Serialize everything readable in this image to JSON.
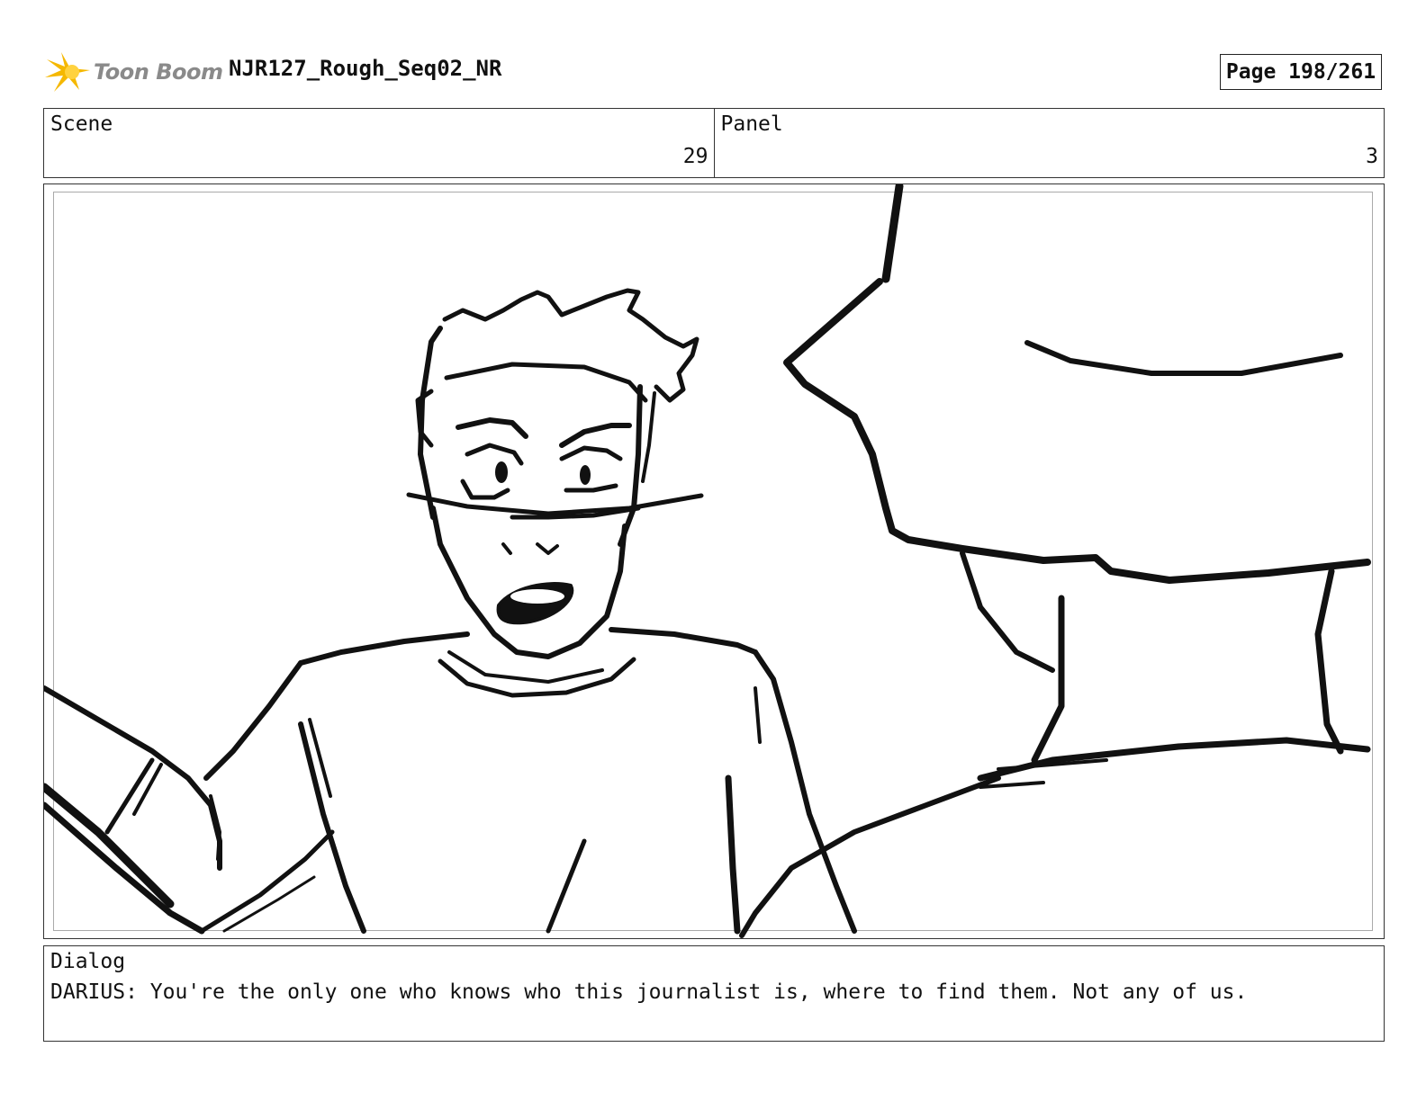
{
  "header": {
    "logo_text": "Toon Boom",
    "project_title": "NJR127_Rough_Seq02_NR",
    "page_indicator": "Page 198/261",
    "logo_color": "#f5b800"
  },
  "scene": {
    "label": "Scene",
    "value": "29"
  },
  "panel": {
    "label": "Panel",
    "value": "3"
  },
  "artwork": {
    "icon": "storyboard-sketch"
  },
  "dialog": {
    "label": "Dialog",
    "text": "DARIUS: You're the only one who knows who this journalist is, where to find them. Not any of us."
  }
}
